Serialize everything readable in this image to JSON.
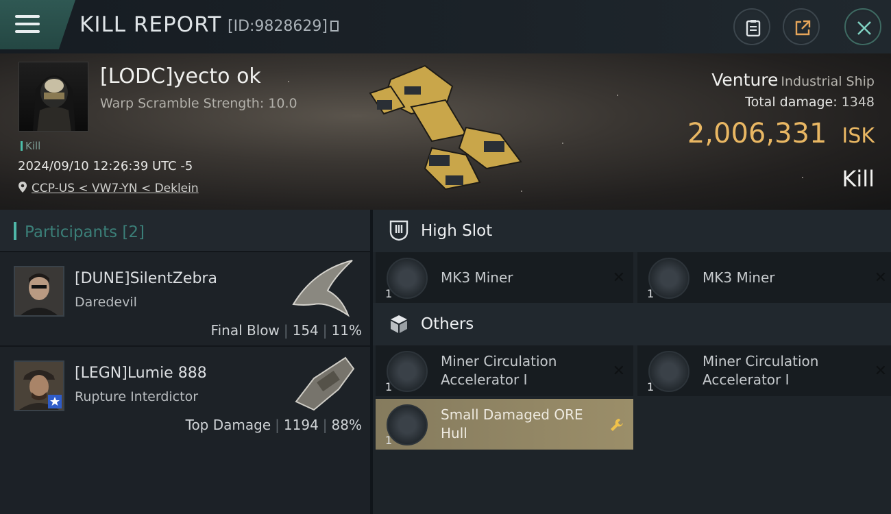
{
  "header": {
    "title": "KILL REPORT",
    "id_text": "[ID:9828629]",
    "icons": [
      "menu-icon",
      "clipboard-icon",
      "share-icon",
      "close-icon"
    ]
  },
  "victim": {
    "name": "[LODC]yecto ok",
    "warp_scramble": "Warp Scramble Strength: 10.0",
    "tag": "Kill",
    "datetime": "2024/09/10 12:26:39 UTC -5",
    "location": "CCP-US < VW7-YN < Deklein",
    "ship": "Venture",
    "ship_class": "Industrial Ship",
    "total_damage_label": "Total damage:",
    "total_damage": "1348",
    "isk_value": "2,006,331",
    "isk_unit": "ISK",
    "result": "Kill"
  },
  "participants": {
    "title": "Participants [2]",
    "rows": [
      {
        "name": "[DUNE]SilentZebra",
        "ship": "Daredevil",
        "role": "Final Blow",
        "damage": "154",
        "percent": "11%"
      },
      {
        "name": "[LEGN]Lumie 888",
        "ship": "Rupture Interdictor",
        "role": "Top Damage",
        "damage": "1194",
        "percent": "88%"
      }
    ]
  },
  "fittings": {
    "high_slot_title": "High Slot",
    "others_title": "Others",
    "high_slots": [
      {
        "name": "MK3 Miner",
        "qty": "1",
        "state": "destroyed"
      },
      {
        "name": "MK3 Miner",
        "qty": "1",
        "state": "destroyed"
      }
    ],
    "others": [
      {
        "name": "Miner Circulation Accelerator I",
        "qty": "1",
        "state": "destroyed"
      },
      {
        "name": "Miner Circulation Accelerator I",
        "qty": "1",
        "state": "destroyed"
      },
      {
        "name": "Small Damaged ORE Hull",
        "qty": "1",
        "state": "dropped"
      }
    ]
  },
  "colors": {
    "accent_teal": "#4fb7a8",
    "isk_gold": "#e9b763",
    "dropped_bg": "#9b8e69"
  }
}
